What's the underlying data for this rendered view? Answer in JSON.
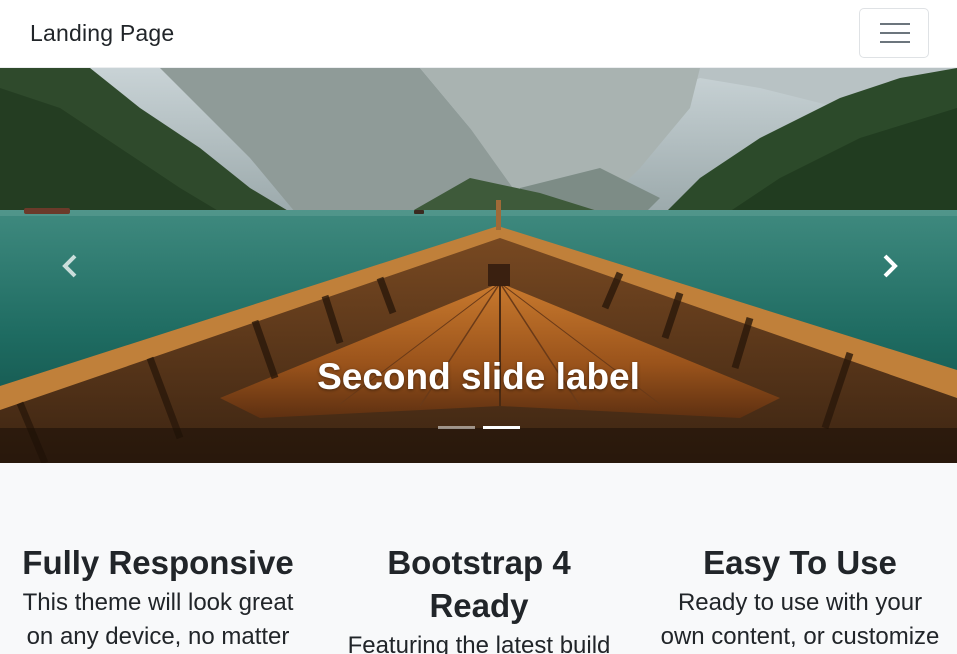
{
  "navbar": {
    "brand": "Landing Page",
    "toggler_icon": "hamburger-menu-icon"
  },
  "carousel": {
    "caption": "Second slide label",
    "prev_icon": "chevron-left-icon",
    "next_icon": "chevron-right-icon",
    "slide_count": 2,
    "active_index": 1
  },
  "features": [
    {
      "title_line1": "Fully Responsive",
      "title_line2": "",
      "text_line1": "This theme will look great",
      "text_line2": "on any device, no matter"
    },
    {
      "title_line1": "Bootstrap 4",
      "title_line2": "Ready",
      "text_line1": "Featuring the latest build",
      "text_line2": ""
    },
    {
      "title_line1": "Easy To Use",
      "title_line2": "",
      "text_line1": "Ready to use with your",
      "text_line2": "own content, or customize"
    }
  ],
  "colors": {
    "navbar_bg": "#ffffff",
    "page_bg": "#f8f9fa",
    "text": "#212529",
    "caption": "#ffffff"
  }
}
